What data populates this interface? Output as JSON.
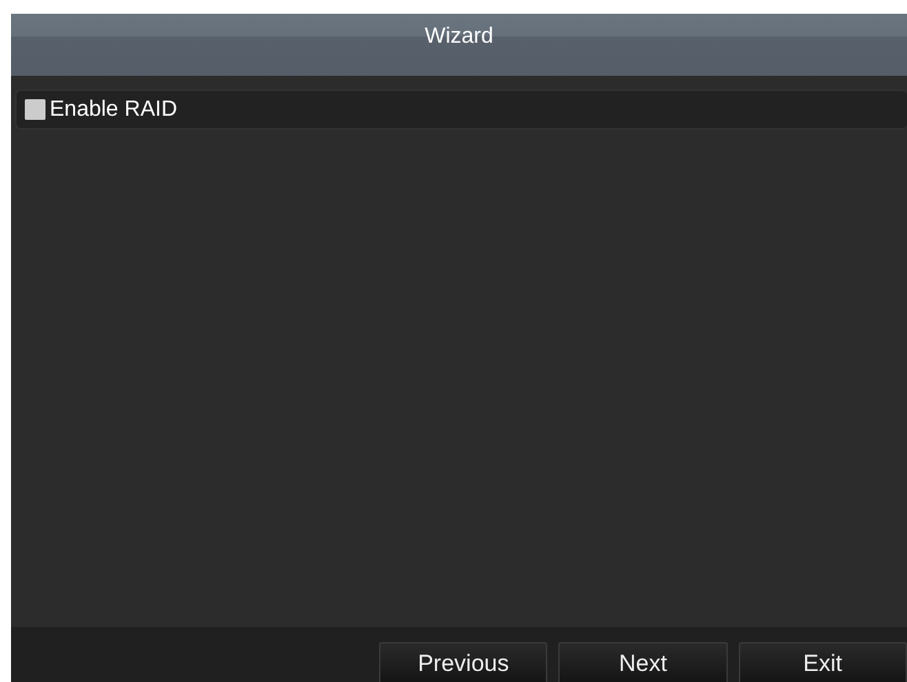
{
  "window": {
    "title": "Wizard"
  },
  "options": [
    {
      "label": "Enable RAID",
      "checked": false
    }
  ],
  "buttons": [
    "Previous",
    "Next",
    "Exit"
  ]
}
